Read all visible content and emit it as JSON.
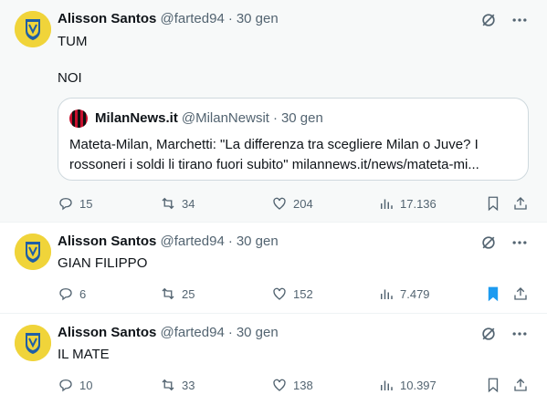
{
  "tweets": [
    {
      "author": "Alisson Santos",
      "handle": "@farted94",
      "separator": "·",
      "date": "30 gen",
      "text_lines": [
        "TUM",
        "NOI"
      ],
      "quote": {
        "author": "MilanNews.it",
        "handle": "@MilanNewsit",
        "separator": "·",
        "date": "30 gen",
        "text": "Mateta-Milan, Marchetti: \"La differenza tra scegliere Milan o Juve? I rossoneri i soldi li tirano fuori subito\" milannews.it/news/mateta-mi..."
      },
      "replies": "15",
      "reposts": "34",
      "likes": "204",
      "views": "17.136",
      "bookmarked": false
    },
    {
      "author": "Alisson Santos",
      "handle": "@farted94",
      "separator": "·",
      "date": "30 gen",
      "text": "GIAN FILIPPO",
      "replies": "6",
      "reposts": "25",
      "likes": "152",
      "views": "7.479",
      "bookmarked": true
    },
    {
      "author": "Alisson Santos",
      "handle": "@farted94",
      "separator": "·",
      "date": "30 gen",
      "text": "IL MATE",
      "replies": "10",
      "reposts": "33",
      "likes": "138",
      "views": "10.397",
      "bookmarked": false
    }
  ],
  "icons": {
    "grok": "grok-icon",
    "more": "more-icon",
    "reply": "reply-icon",
    "repost": "repost-icon",
    "like": "like-icon",
    "views": "views-icon",
    "bookmark": "bookmark-icon",
    "share": "share-icon"
  },
  "colors": {
    "text": "#0f1419",
    "secondary": "#536471",
    "accent": "#1d9bf0",
    "avatar": "#f0d43a",
    "border": "#cfd9de"
  }
}
